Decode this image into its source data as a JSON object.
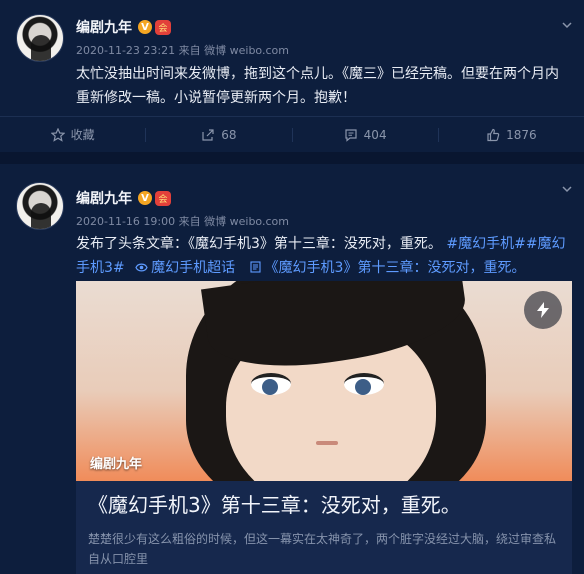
{
  "posts": [
    {
      "author": "编剧九年",
      "badge": "V",
      "member_badge": "会",
      "timestamp": "2020-11-23 23:21",
      "source": "来自 微博 weibo.com",
      "text": "太忙没抽出时间来发微博，拖到这个点儿。《魔三》已经完稿。但要在两个月内重新修改一稿。小说暂停更新两个月。抱歉！",
      "actions": {
        "favorite": "收藏",
        "repost": "68",
        "comment": "404",
        "like": "1876"
      }
    },
    {
      "author": "编剧九年",
      "badge": "V",
      "member_badge": "会",
      "timestamp": "2020-11-16 19:00",
      "source": "来自 微博 weibo.com",
      "text_prefix": "发布了头条文章：《魔幻手机3》第十三章：没死对，重死。",
      "hashtag1": "#魔幻手机#",
      "hashtag2_line1": "#魔幻",
      "hashtag2_line2": "手机3#",
      "supertopic": "魔幻手机超话",
      "article_link": "《魔幻手机3》第十三章：没死对，重死。",
      "card": {
        "image_caption": "编剧九年",
        "title": "《魔幻手机3》第十三章：没死对，重死。",
        "excerpt": "楚楚很少有这么粗俗的时候，但这一幕实在太神奇了，两个脏字没经过大脑，绕过审查私自从口腔里"
      }
    }
  ],
  "colors": {
    "background": "#0b1b39",
    "card_bg": "#0d1e3d",
    "link": "#5e9bff",
    "muted": "#7f8aa3"
  }
}
